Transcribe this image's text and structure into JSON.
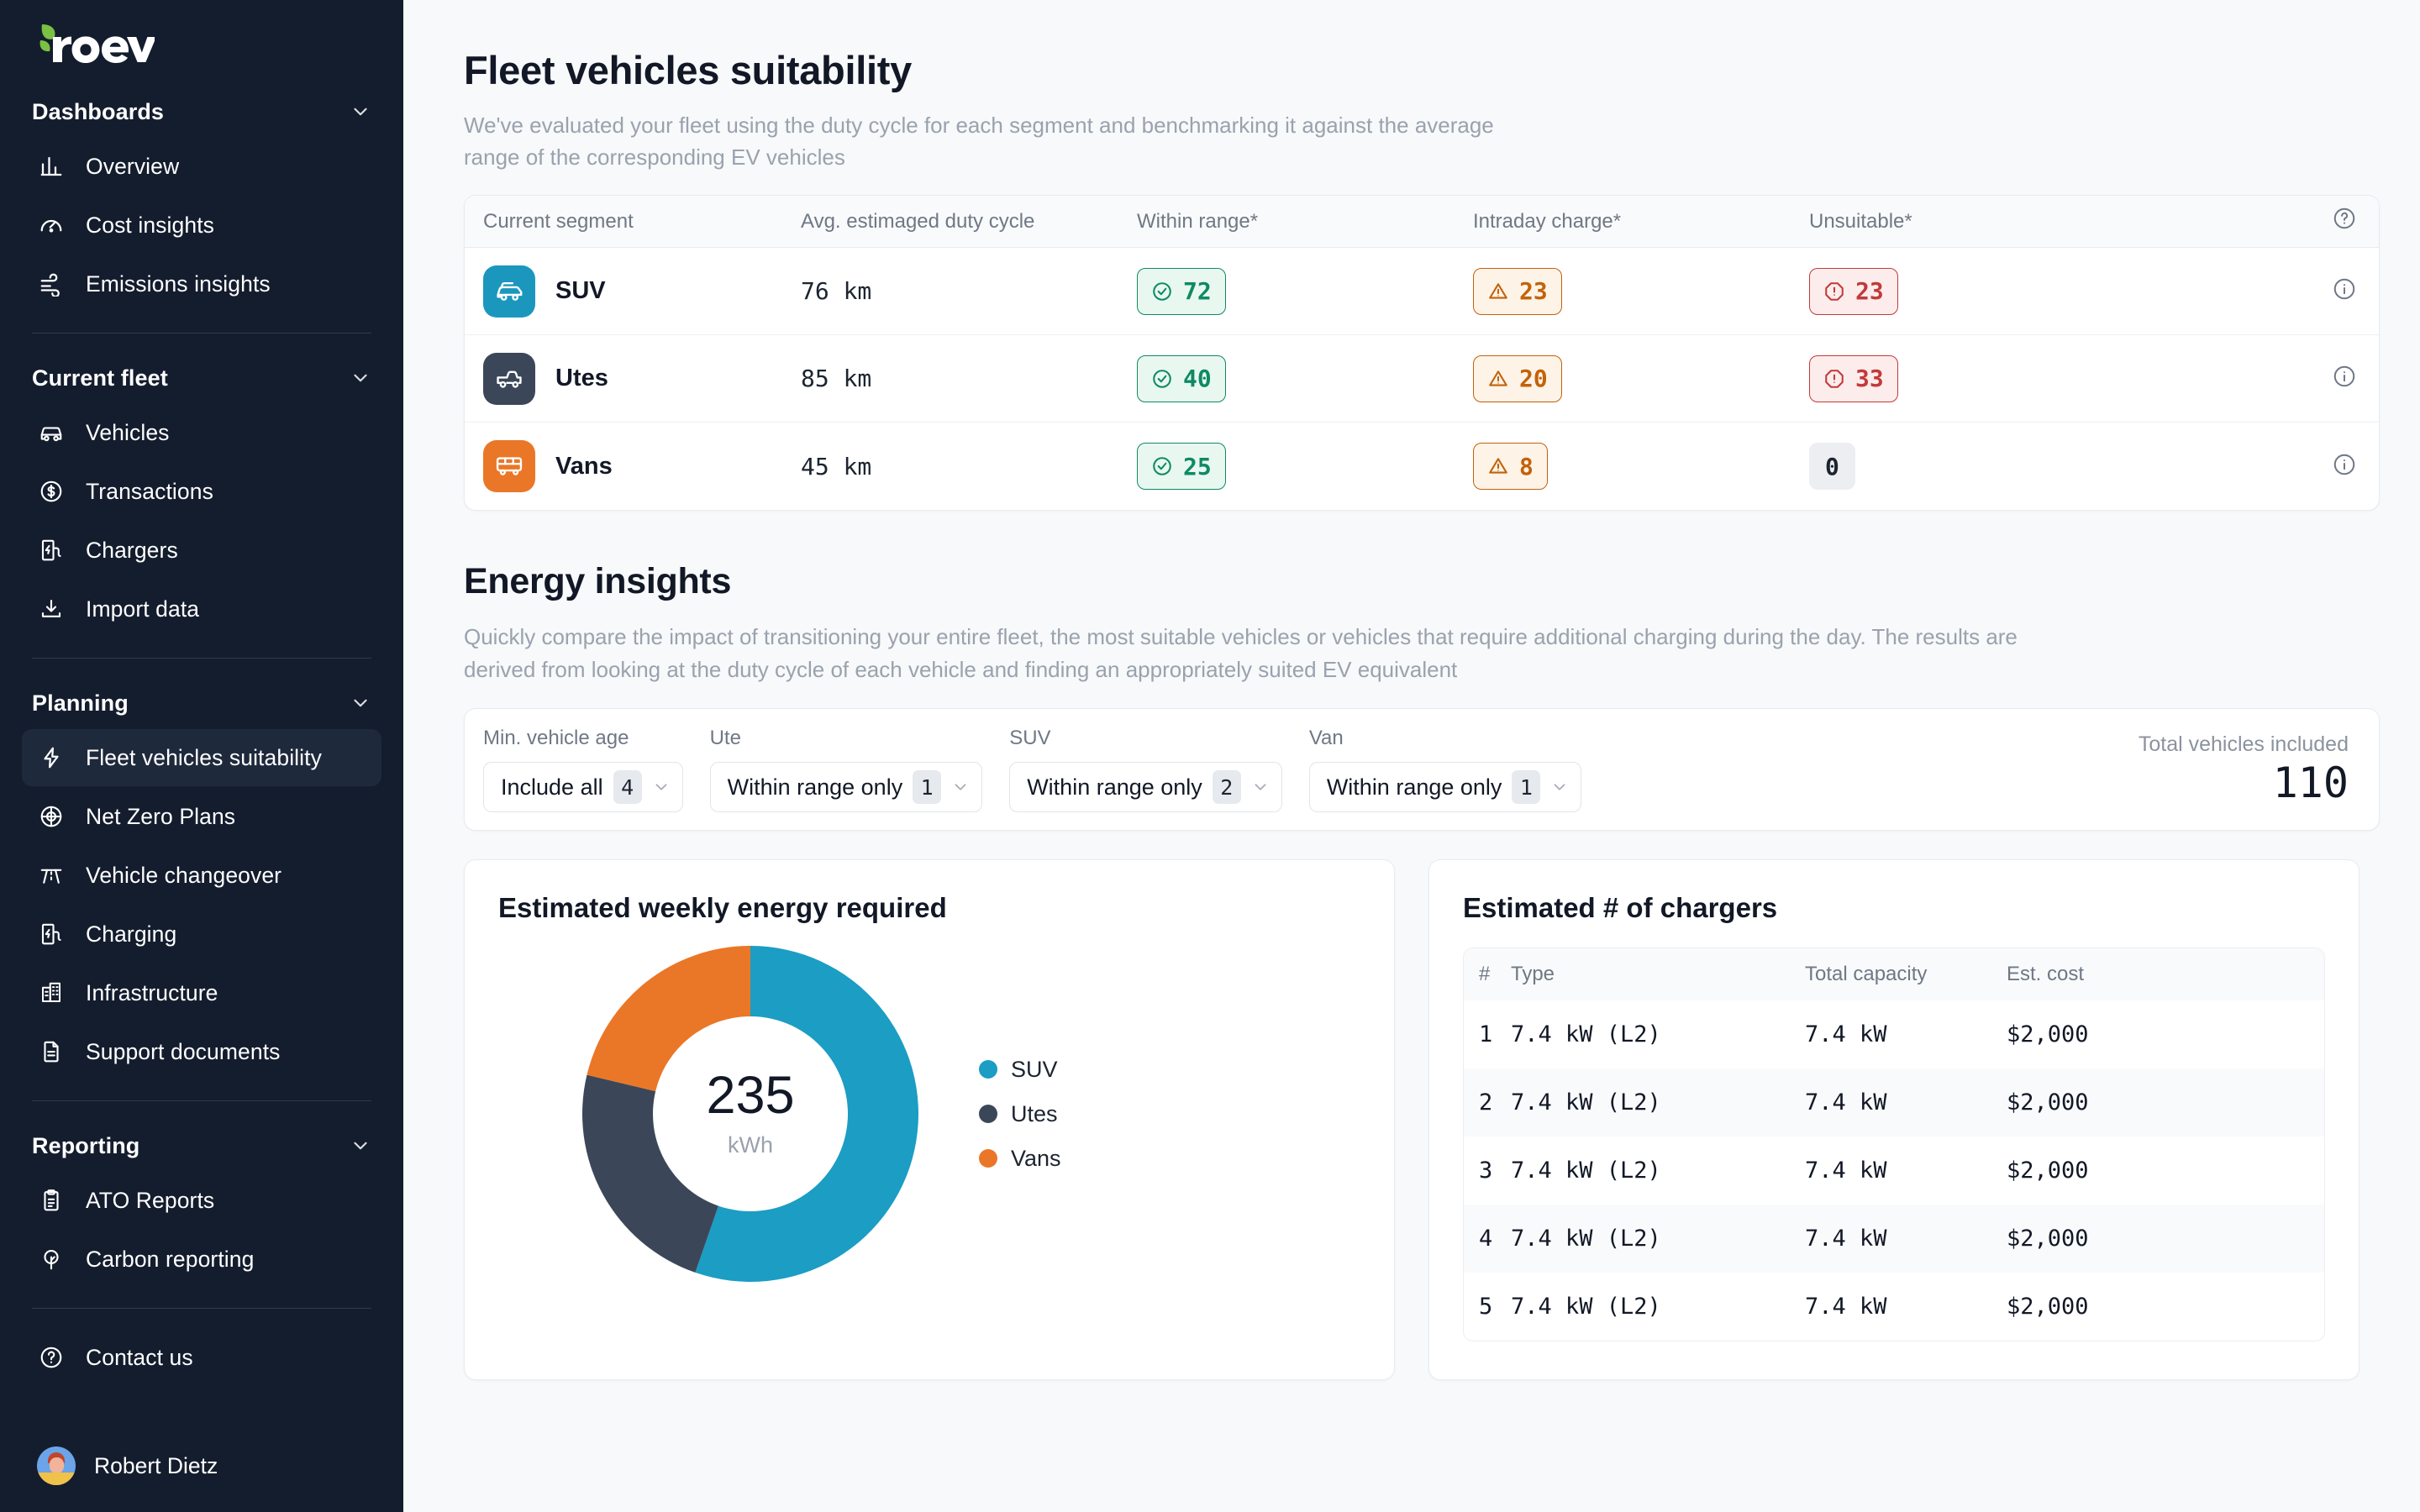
{
  "brand": {
    "name": "roev",
    "leaf_color": "#7ac143",
    "sidebar_bg": "#141d2e"
  },
  "sidebar": {
    "groups": [
      {
        "label": "Dashboards",
        "items": [
          {
            "label": "Overview",
            "icon": "bar-chart-icon",
            "active": false
          },
          {
            "label": "Cost insights",
            "icon": "gauge-icon",
            "active": false
          },
          {
            "label": "Emissions insights",
            "icon": "wind-icon",
            "active": false
          }
        ]
      },
      {
        "label": "Current fleet",
        "items": [
          {
            "label": "Vehicles",
            "icon": "car-icon",
            "active": false
          },
          {
            "label": "Transactions",
            "icon": "dollar-circle-icon",
            "active": false
          },
          {
            "label": "Chargers",
            "icon": "charging-station-icon",
            "active": false
          },
          {
            "label": "Import data",
            "icon": "download-icon",
            "active": false
          }
        ]
      },
      {
        "label": "Planning",
        "items": [
          {
            "label": "Fleet vehicles suitability",
            "icon": "lightning-icon",
            "active": true
          },
          {
            "label": "Net Zero Plans",
            "icon": "target-icon",
            "active": false
          },
          {
            "label": "Vehicle changeover",
            "icon": "road-icon",
            "active": false
          },
          {
            "label": "Charging",
            "icon": "charging-station-icon",
            "active": false
          },
          {
            "label": "Infrastructure",
            "icon": "building-icon",
            "active": false
          },
          {
            "label": "Support documents",
            "icon": "document-icon",
            "active": false
          }
        ]
      },
      {
        "label": "Reporting",
        "items": [
          {
            "label": "ATO Reports",
            "icon": "clipboard-icon",
            "active": false
          },
          {
            "label": "Carbon reporting",
            "icon": "tree-icon",
            "active": false
          }
        ]
      }
    ],
    "contact": {
      "label": "Contact us",
      "icon": "question-circle-icon"
    },
    "user": {
      "name": "Robert Dietz"
    }
  },
  "page": {
    "title": "Fleet vehicles suitability",
    "subtitle": "We've evaluated your fleet using the duty cycle for each segment and benchmarking it against the average range of the corresponding EV vehicles"
  },
  "suitability_table": {
    "columns": [
      "Current segment",
      "Avg. estimaged duty cycle",
      "Within range*",
      "Intraday charge*",
      "Unsuitable*"
    ],
    "help_icon": "question-circle-icon",
    "rows": [
      {
        "segment": "SUV",
        "icon": "suv-icon",
        "icon_color": "#1b97be",
        "duty_cycle": "76  km",
        "within_range": "72",
        "intraday_charge": "23",
        "unsuitable": "23",
        "unsuitable_style": "red",
        "info_icon": "info-circle-icon"
      },
      {
        "segment": "Utes",
        "icon": "ute-icon",
        "icon_color": "#3b4759",
        "duty_cycle": "85  km",
        "within_range": "40",
        "intraday_charge": "20",
        "unsuitable": "33",
        "unsuitable_style": "red",
        "info_icon": "info-circle-icon"
      },
      {
        "segment": "Vans",
        "icon": "van-icon",
        "icon_color": "#ea7727",
        "duty_cycle": "45  km",
        "within_range": "25",
        "intraday_charge": "8",
        "unsuitable": "0",
        "unsuitable_style": "gray",
        "info_icon": "info-circle-icon"
      }
    ]
  },
  "energy": {
    "title": "Energy insights",
    "subtitle": "Quickly compare the impact of transitioning your entire fleet, the most suitable vehicles or vehicles that require additional charging during the day. The results are derived from looking at the duty cycle of each vehicle and finding an appropriately suited EV equivalent",
    "filters": [
      {
        "label": "Min. vehicle age",
        "value": "Include all",
        "count": "4"
      },
      {
        "label": "Ute",
        "value": "Within range only",
        "count": "1"
      },
      {
        "label": "SUV",
        "value": "Within range only",
        "count": "2"
      },
      {
        "label": "Van",
        "value": "Within range only",
        "count": "1"
      }
    ],
    "total_label": "Total vehicles included",
    "total_value": "110"
  },
  "chart_data": {
    "type": "pie",
    "title": "Estimated weekly energy required",
    "center_value": "235",
    "center_unit": "kWh",
    "labels": [
      "SUV",
      "Utes",
      "Vans"
    ],
    "values": [
      130,
      55,
      50
    ],
    "percentages": [
      55.5,
      23.5,
      21.0
    ],
    "colors": [
      "#1b9dc4",
      "#3b4759",
      "#ea7727"
    ],
    "legend_position": "right",
    "start_angle_deg": 0,
    "hole_ratio": 0.58,
    "units": "kWh",
    "total": 235
  },
  "chargers": {
    "title": "Estimated # of chargers",
    "columns": [
      "#",
      "Type",
      "Total capacity",
      "Est. cost"
    ],
    "rows": [
      {
        "num": "1",
        "type": "7.4 kW (L2)",
        "capacity": "7.4 kW",
        "cost": "$2,000"
      },
      {
        "num": "2",
        "type": "7.4 kW (L2)",
        "capacity": "7.4 kW",
        "cost": "$2,000"
      },
      {
        "num": "3",
        "type": "7.4 kW (L2)",
        "capacity": "7.4 kW",
        "cost": "$2,000"
      },
      {
        "num": "4",
        "type": "7.4 kW (L2)",
        "capacity": "7.4 kW",
        "cost": "$2,000"
      },
      {
        "num": "5",
        "type": "7.4 kW (L2)",
        "capacity": "7.4 kW",
        "cost": "$2,000"
      }
    ]
  }
}
